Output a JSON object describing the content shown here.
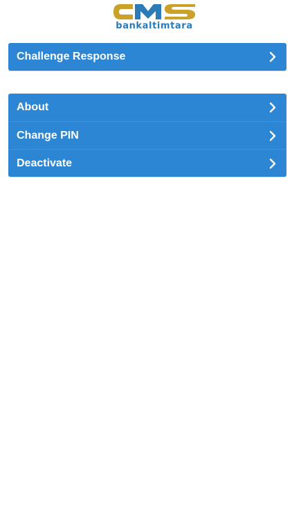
{
  "logo": {
    "mark_text": "CMS",
    "subtitle": "bankaltimtara",
    "colors": {
      "gold": "#c9a227",
      "blue": "#2a7bb8"
    }
  },
  "menu": {
    "groups": [
      {
        "items": [
          {
            "label": "Challenge Response",
            "icon": "chevron-right-icon"
          }
        ]
      },
      {
        "items": [
          {
            "label": "About",
            "icon": "chevron-right-icon"
          },
          {
            "label": "Change PIN",
            "icon": "chevron-right-icon"
          },
          {
            "label": "Deactivate",
            "icon": "chevron-right-icon"
          }
        ]
      }
    ]
  },
  "theme": {
    "accent": "#2c86d3",
    "background": "#ffffff",
    "text_on_accent": "#ffffff"
  }
}
